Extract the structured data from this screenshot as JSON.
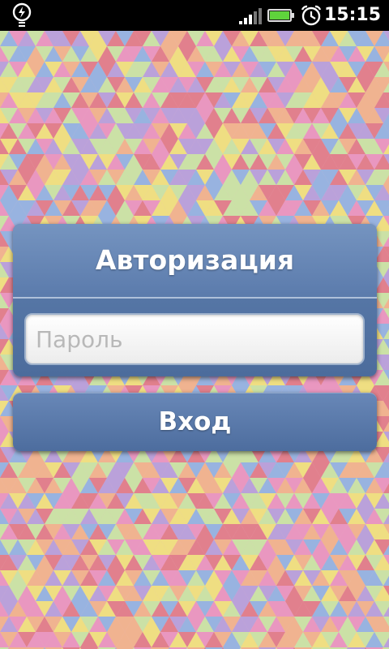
{
  "status_bar": {
    "time": "15:15",
    "icons": [
      "power-save-icon",
      "signal-icon",
      "battery-icon",
      "alarm-icon"
    ]
  },
  "auth": {
    "title": "Авторизация",
    "password_placeholder": "Пароль",
    "password_value": "",
    "login_label": "Вход"
  },
  "colors": {
    "panel": "#5b7bac",
    "pattern": [
      "#e07a86",
      "#f0e27a",
      "#8fb2e2",
      "#e993bf",
      "#c8e6a2",
      "#f1b28a",
      "#b59fdc"
    ]
  }
}
